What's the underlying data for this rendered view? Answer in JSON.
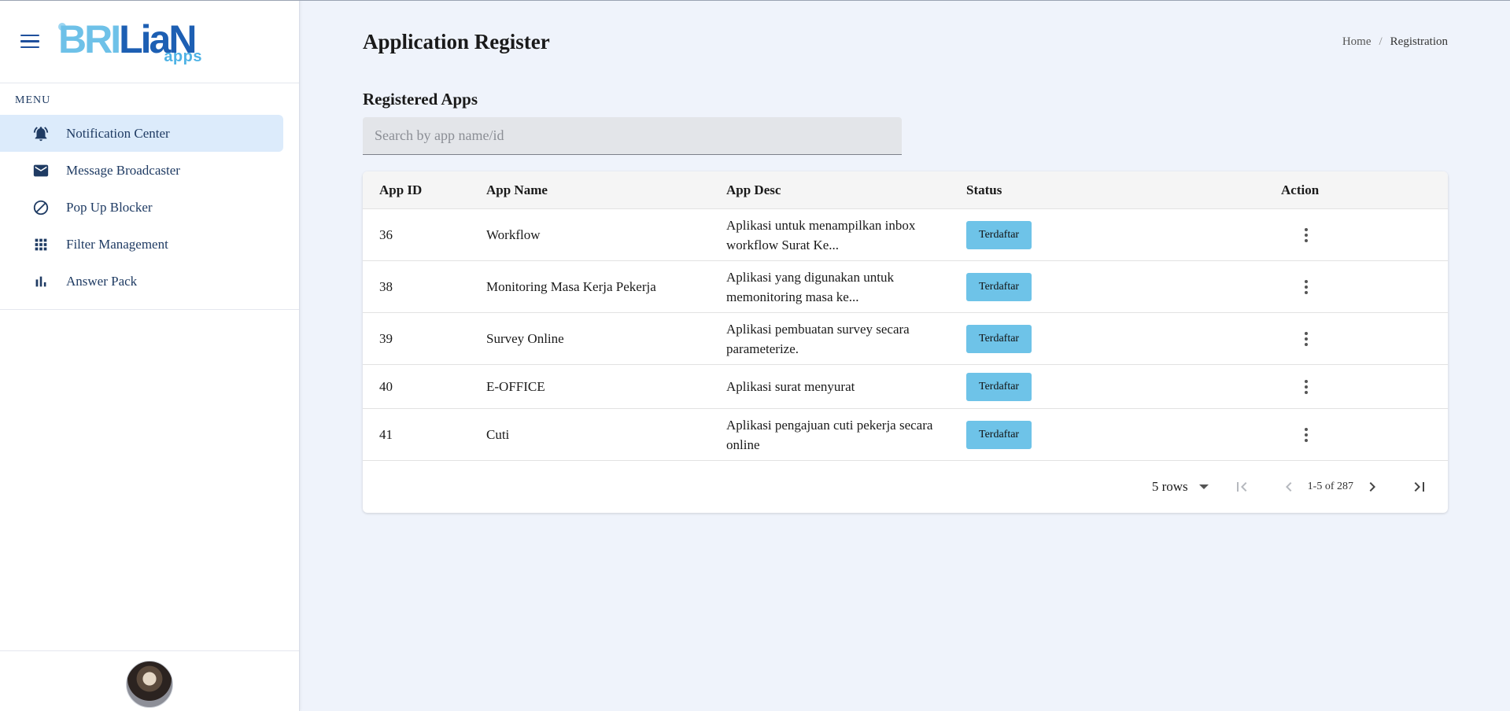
{
  "brand": {
    "logo_text_light": "BRI",
    "logo_text_dark": "LiaN",
    "logo_sub": "apps"
  },
  "sidebar": {
    "menu_label": "MENU",
    "items": [
      {
        "label": "Notification Center",
        "icon": "bell-icon",
        "active": true
      },
      {
        "label": "Message Broadcaster",
        "icon": "envelope-icon",
        "active": false
      },
      {
        "label": "Pop Up Blocker",
        "icon": "block-icon",
        "active": false
      },
      {
        "label": "Filter Management",
        "icon": "grid-icon",
        "active": false
      },
      {
        "label": "Answer Pack",
        "icon": "bar-chart-icon",
        "active": false
      }
    ]
  },
  "header": {
    "title": "Application Register",
    "breadcrumb": {
      "home": "Home",
      "separator": "/",
      "current": "Registration"
    }
  },
  "section": {
    "title": "Registered Apps"
  },
  "search": {
    "placeholder": "Search by app name/id",
    "value": ""
  },
  "table": {
    "columns": {
      "id": "App ID",
      "name": "App Name",
      "desc": "App Desc",
      "status": "Status",
      "action": "Action"
    },
    "rows": [
      {
        "id": "36",
        "name": "Workflow",
        "desc": "Aplikasi untuk menampilkan inbox workflow Surat Ke...",
        "status": "Terdaftar"
      },
      {
        "id": "38",
        "name": "Monitoring Masa Kerja Pekerja",
        "desc": "Aplikasi yang digunakan untuk memonitoring masa ke...",
        "status": "Terdaftar"
      },
      {
        "id": "39",
        "name": "Survey Online",
        "desc": "Aplikasi pembuatan survey secara parameterize.",
        "status": "Terdaftar"
      },
      {
        "id": "40",
        "name": "E-OFFICE",
        "desc": "Aplikasi surat menyurat",
        "status": "Terdaftar"
      },
      {
        "id": "41",
        "name": "Cuti",
        "desc": "Aplikasi pengajuan cuti pekerja secara online",
        "status": "Terdaftar"
      }
    ]
  },
  "pagination": {
    "rows_label": "5 rows",
    "range": "1-5 of 287"
  },
  "colors": {
    "accent": "#1d5fb3",
    "badge": "#6ec3e8",
    "active_nav": "#dcebfb",
    "background": "#eff3fb"
  }
}
